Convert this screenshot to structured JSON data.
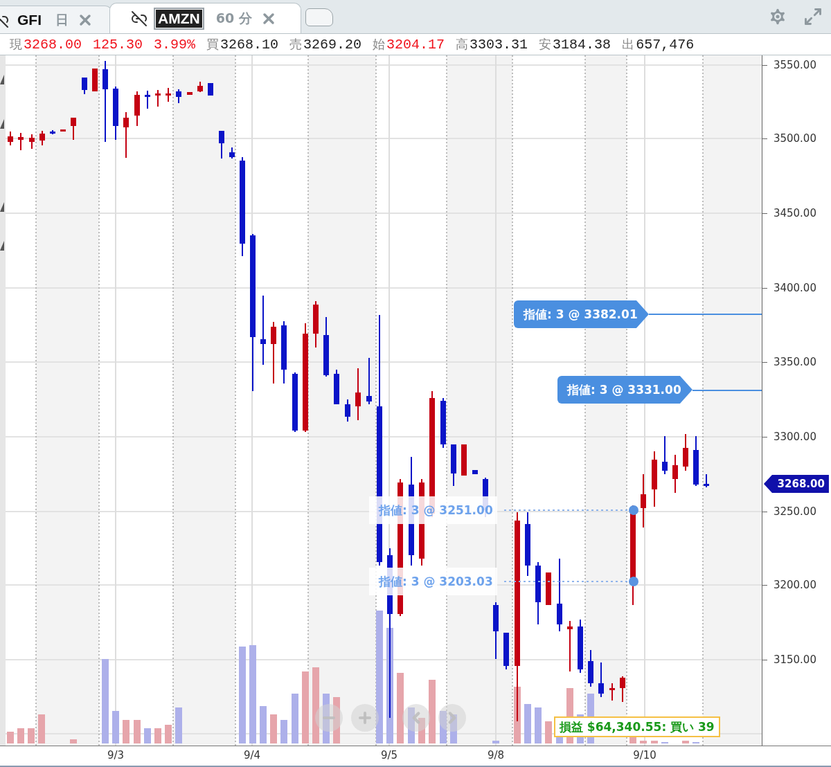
{
  "tabs": [
    {
      "symbol": "GFI",
      "interval": "日",
      "selected": false
    },
    {
      "symbol": "AMZN",
      "interval": "60 分",
      "selected": true
    }
  ],
  "quote": [
    {
      "label": "現",
      "value": "3268.00",
      "highlight": true
    },
    {
      "value": "125.30",
      "highlight": true
    },
    {
      "value": "3.99%",
      "highlight": true
    },
    {
      "label": "買",
      "value": "3268.10",
      "highlight": false
    },
    {
      "label": "売",
      "value": "3269.20",
      "highlight": false
    },
    {
      "label": "始",
      "value": "3204.17",
      "highlight": true
    },
    {
      "label": "高",
      "value": "3303.31",
      "highlight": false
    },
    {
      "label": "安",
      "value": "3184.38",
      "highlight": false
    },
    {
      "label": "出",
      "value": "657,476",
      "highlight": false
    }
  ],
  "chart": {
    "y_ticks": [
      "3550.00",
      "3500.00",
      "3450.00",
      "3400.00",
      "3350.00",
      "3300.00",
      "3250.00",
      "3200.00",
      "3150.00"
    ],
    "x_labels": [
      "9/3",
      "9/4",
      "9/5",
      "9/8",
      "9/10"
    ],
    "current_price": "3268.00",
    "orders": [
      {
        "text": "指値: 3 @ 3382.01",
        "dimmed": false
      },
      {
        "text": "指値: 3 @ 3331.00",
        "dimmed": false
      },
      {
        "text": "指値: 3 @ 3251.00",
        "dimmed": true
      },
      {
        "text": "指値: 3 @ 3203.03",
        "dimmed": true
      }
    ],
    "pnl": "損益 $64,340.55: 買い 39"
  }
}
